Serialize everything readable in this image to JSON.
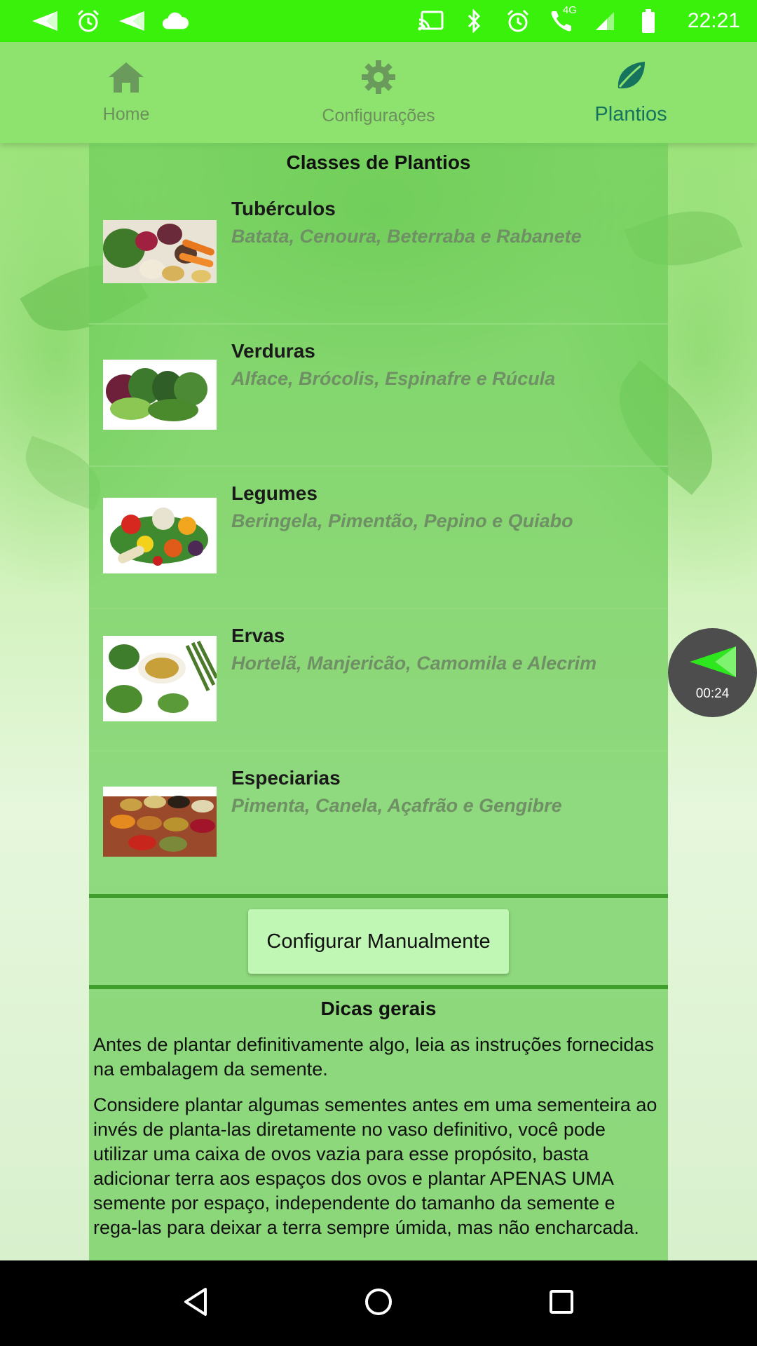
{
  "status_bar": {
    "time": "22:21",
    "left_icons": [
      "send-icon",
      "alarm-icon",
      "send-icon",
      "cloud-icon"
    ],
    "right_icons": [
      "cast-icon",
      "bluetooth-icon",
      "alarm-icon",
      "wifi-call-icon",
      "signal-icon",
      "battery-icon"
    ],
    "network_label": "4G",
    "color": "#39f10a"
  },
  "nav": {
    "tabs": [
      {
        "label": "Home",
        "icon": "home-icon",
        "active": false
      },
      {
        "label": "Configurações",
        "icon": "gear-icon",
        "active": false
      },
      {
        "label": "Plantios",
        "icon": "leaf-icon",
        "active": true
      }
    ],
    "active_color": "#15735e"
  },
  "classes": {
    "title": "Classes de Plantios",
    "items": [
      {
        "name": "Tubérculos",
        "desc": "Batata, Cenoura, Beterraba e Rabanete"
      },
      {
        "name": "Verduras",
        "desc": "Alface, Brócolis, Espinafre e Rúcula"
      },
      {
        "name": "Legumes",
        "desc": "Beringela, Pimentão, Pepino e Quiabo"
      },
      {
        "name": "Ervas",
        "desc": "Hortelã, Manjericão, Camomila e Alecrim"
      },
      {
        "name": "Especiarias",
        "desc": "Pimenta, Canela, Açafrão e Gengibre"
      }
    ]
  },
  "manual_button": {
    "label": "Configurar Manualmente"
  },
  "tips": {
    "title": "Dicas gerais",
    "paragraphs": [
      "Antes de plantar definitivamente algo, leia as instruções fornecidas na embalagem da semente.",
      "Considere plantar algumas sementes antes em uma sementeira ao invés de planta-las diretamente no vaso definitivo, você pode utilizar uma caixa de ovos vazia para esse propósito, basta adicionar terra aos espaços dos ovos e plantar APENAS UMA semente por espaço, independente do tamanho da semente e rega-las para deixar a terra sempre úmida, mas não encharcada."
    ]
  },
  "bubble": {
    "time": "00:24",
    "icon": "send-icon"
  },
  "system_nav": {
    "icons": [
      "back-icon",
      "home-circle-icon",
      "recents-icon"
    ]
  }
}
